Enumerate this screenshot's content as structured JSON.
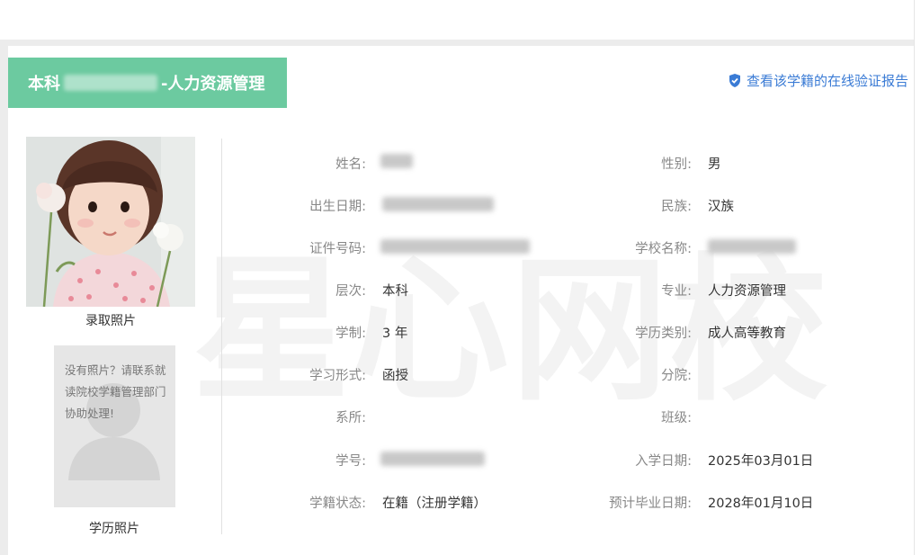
{
  "header": {
    "title_prefix": "本科",
    "title_suffix": "-人力资源管理",
    "verify_link": "查看该学籍的在线验证报告"
  },
  "watermark": "星心网校",
  "photos": {
    "admission_caption": "录取照片",
    "degree_caption": "学历照片",
    "missing_text": "没有照片？请联系就读院校学籍管理部门协助处理!"
  },
  "fields": {
    "name_label": "姓名:",
    "gender_label": "性别:",
    "gender_value": "男",
    "birth_label": "出生日期:",
    "ethnicity_label": "民族:",
    "ethnicity_value": "汉族",
    "id_label": "证件号码:",
    "school_label": "学校名称:",
    "level_label": "层次:",
    "level_value": "本科",
    "major_label": "专业:",
    "major_value": "人力资源管理",
    "duration_label": "学制:",
    "duration_value": "3 年",
    "edu_type_label": "学历类别:",
    "edu_type_value": "成人高等教育",
    "study_form_label": "学习形式:",
    "study_form_value": "函授",
    "branch_label": "分院:",
    "dept_label": "系所:",
    "class_label": "班级:",
    "student_id_label": "学号:",
    "enroll_date_label": "入学日期:",
    "enroll_date_value": "2025年03月01日",
    "status_label": "学籍状态:",
    "status_value": "在籍（注册学籍）",
    "grad_date_label": "预计毕业日期:",
    "grad_date_value": "2028年01月10日"
  },
  "colors": {
    "tab_green": "#6ccaa0",
    "link_blue": "#3a7bd5"
  }
}
